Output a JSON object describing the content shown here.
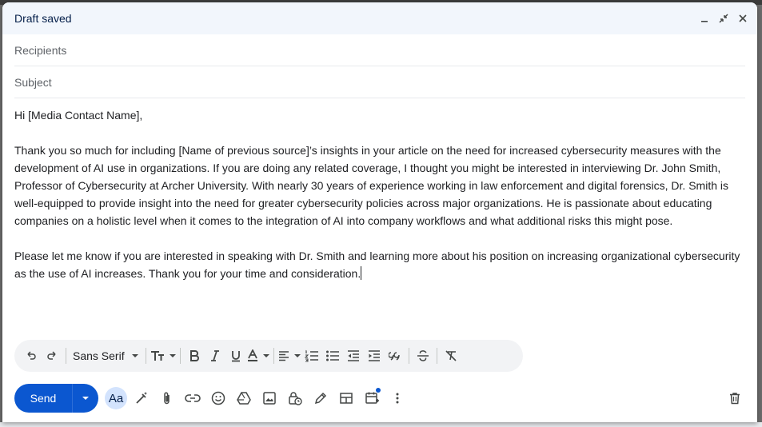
{
  "header": {
    "title": "Draft saved"
  },
  "fields": {
    "recipients_placeholder": "Recipients",
    "subject_placeholder": "Subject"
  },
  "body": {
    "greeting": "Hi [Media Contact Name],",
    "paragraph1": "Thank you so much for including [Name of previous source]’s insights in your article on the need for increased cybersecurity measures with the development of AI use in organizations. If you are doing any related coverage, I thought you might be interested in interviewing Dr. John Smith, Professor of Cybersecurity at Archer University. With nearly 30 years of experience working in law enforcement and digital forensics, Dr. Smith is well-equipped to provide insight into the need for greater cybersecurity policies across major organizations. He is passionate about educating companies on a holistic level when it comes to the integration of AI into company workflows and what additional risks this might pose.",
    "paragraph2": "Please let me know if you are interested in speaking with Dr. Smith and learning more about his position on increasing organizational cybersecurity as the use of AI increases. Thank you for your time and consideration."
  },
  "formatting": {
    "font": "Sans Serif"
  },
  "actions": {
    "send_label": "Send",
    "text_format_label": "Aa"
  },
  "colors": {
    "accent": "#0b57d0",
    "header_bg": "#f2f6fc",
    "toolbar_bg": "#f2f3f5"
  }
}
